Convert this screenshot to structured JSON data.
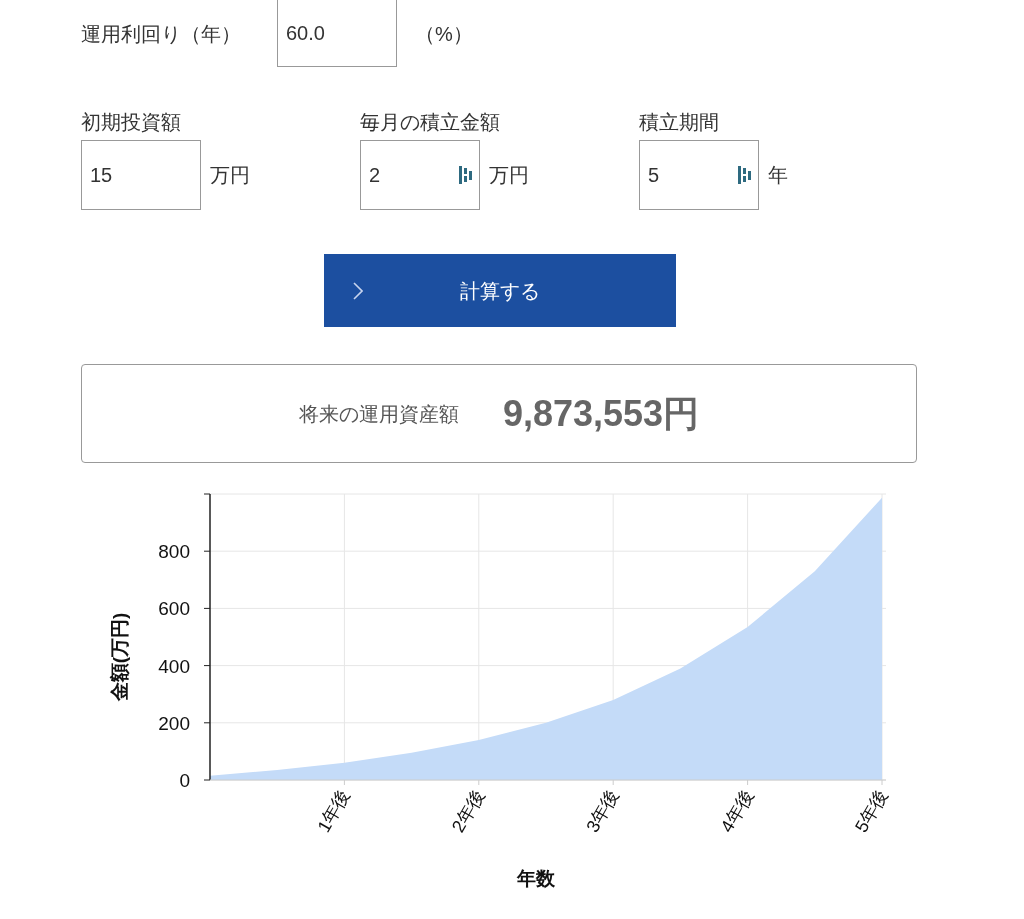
{
  "rate": {
    "label": "運用利回り（年）",
    "value": "60.0",
    "unit": "（%）"
  },
  "fields": [
    {
      "label": "初期投資額",
      "value": "15",
      "unit": "万円",
      "spinner": false
    },
    {
      "label": "毎月の積立金額",
      "value": "2",
      "unit": "万円",
      "spinner": true
    },
    {
      "label": "積立期間",
      "value": "5",
      "unit": "年",
      "spinner": true
    }
  ],
  "button": {
    "label": "計算する"
  },
  "result": {
    "label": "将来の運用資産額",
    "value": "9,873,553円"
  },
  "chart_data": {
    "type": "area",
    "xlabel": "年数",
    "ylabel": "金額(万円)",
    "x": [
      0,
      0.5,
      1,
      1.5,
      2,
      2.5,
      3,
      3.5,
      4,
      4.5,
      5
    ],
    "grid": true,
    "series": [
      {
        "color": "#c4dbf8",
        "values": [
          15,
          35,
          60,
          95,
          140,
          200,
          280,
          390,
          535,
          730,
          987
        ]
      }
    ],
    "xlim": [
      0,
      5
    ],
    "ylim": [
      0,
      1000
    ],
    "xticks": [
      {
        "value": 1,
        "label": "1年後"
      },
      {
        "value": 2,
        "label": "2年後"
      },
      {
        "value": 3,
        "label": "3年後"
      },
      {
        "value": 4,
        "label": "4年後"
      },
      {
        "value": 5,
        "label": "5年後"
      }
    ],
    "yticks": [
      0,
      200,
      400,
      600,
      800
    ]
  }
}
